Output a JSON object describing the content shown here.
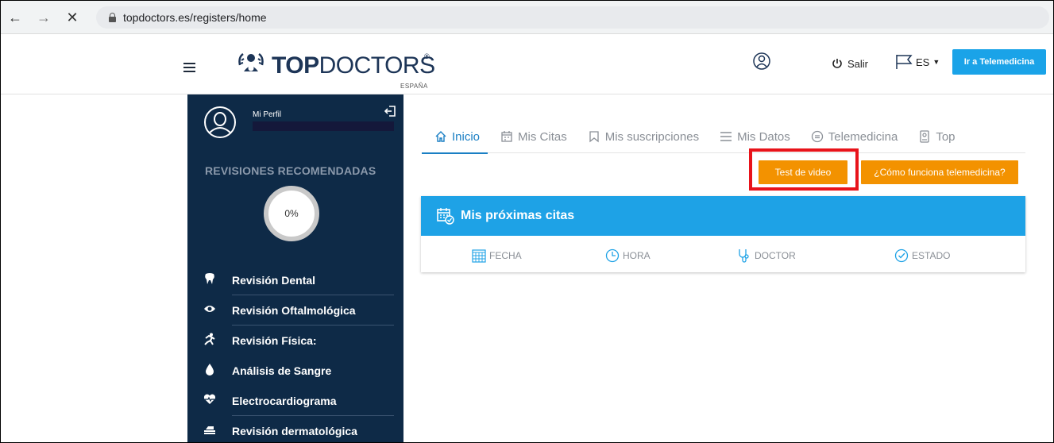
{
  "browser": {
    "back_icon": "arrow-left-icon",
    "forward_icon": "arrow-right-icon",
    "stop_icon": "close-icon",
    "url": "topdoctors.es/registers/home"
  },
  "header": {
    "logo_top": "TOP",
    "logo_bottom": "DOCTORS",
    "logo_sub": "ESPAÑA",
    "logout_label": "Salir",
    "lang_label": "ES",
    "tele_button": "Ir a Telemedicina"
  },
  "sidebar": {
    "profile_label": "Mi Perfil",
    "section_title": "REVISIONES RECOMENDADAS",
    "progress_label": "0%",
    "progress_value": 0,
    "items": [
      {
        "label": "Revisión Dental",
        "icon": "tooth-icon"
      },
      {
        "label": "Revisión Oftalmológica",
        "icon": "eye-icon"
      },
      {
        "label": "Revisión Física:",
        "icon": "running-icon"
      },
      {
        "label": "Análisis de Sangre",
        "icon": "drop-icon"
      },
      {
        "label": "Electrocardiograma",
        "icon": "heartbeat-icon"
      },
      {
        "label": "Revisión dermatológica",
        "icon": "skin-icon"
      }
    ]
  },
  "tabs": [
    {
      "label": "Inicio",
      "icon": "home-icon",
      "active": true
    },
    {
      "label": "Mis Citas",
      "icon": "calendar-icon"
    },
    {
      "label": "Mis suscripciones",
      "icon": "bookmark-icon"
    },
    {
      "label": "Mis Datos",
      "icon": "list-icon"
    },
    {
      "label": "Telemedicina",
      "icon": "chat-icon"
    },
    {
      "label": "Top",
      "icon": "badge-icon"
    }
  ],
  "actions": {
    "test_video": "Test de video",
    "como_funciona": "¿Cómo funciona telemedicina?"
  },
  "appointments": {
    "title": "Mis próximas citas",
    "columns": [
      "FECHA",
      "HORA",
      "DOCTOR",
      "ESTADO"
    ]
  },
  "colors": {
    "sidebar_bg": "#0e2a47",
    "accent_blue": "#1ea2e6",
    "accent_orange": "#f39200",
    "highlight_red": "#e8131a"
  }
}
